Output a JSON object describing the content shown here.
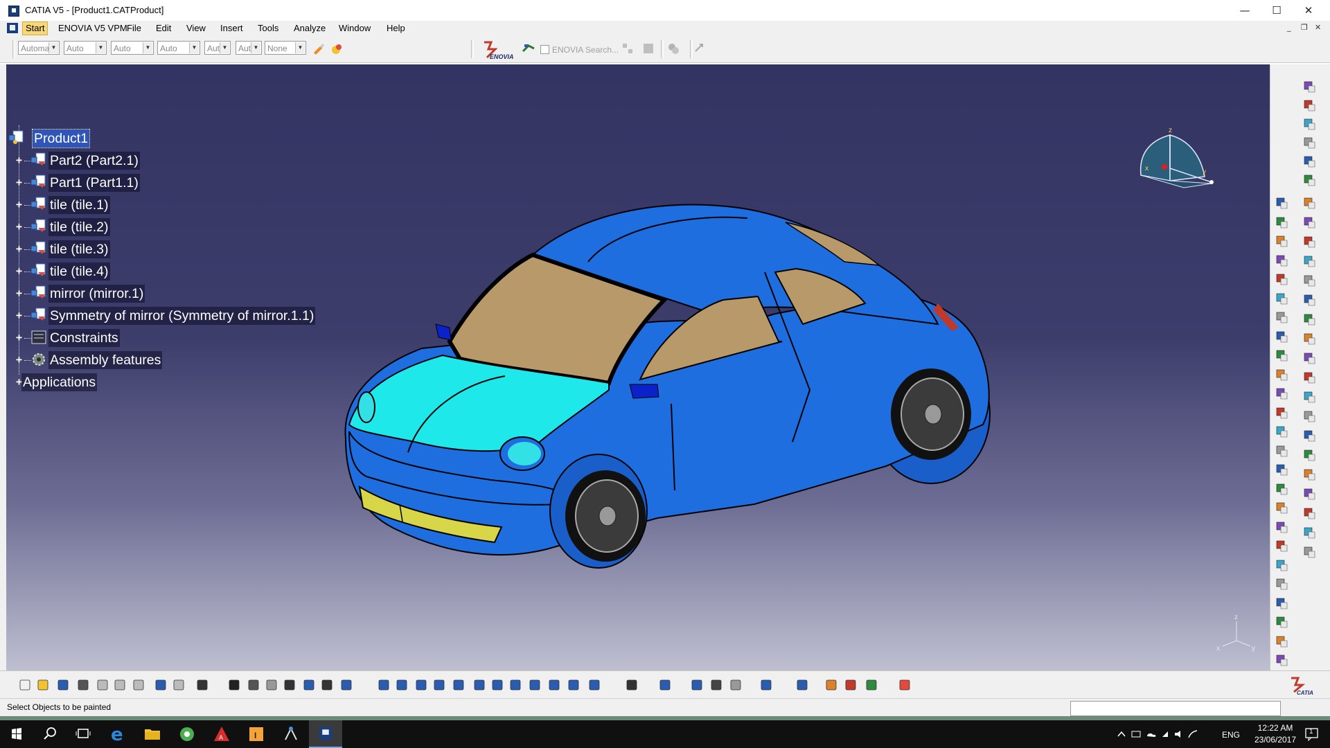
{
  "window": {
    "title": "CATIA V5 - [Product1.CATProduct]",
    "minimize": "—",
    "maximize": "☐",
    "close": "✕"
  },
  "menu": {
    "items": [
      "Start",
      "ENOVIA V5 VPM",
      "File",
      "Edit",
      "View",
      "Insert",
      "Tools",
      "Analyze",
      "Window",
      "Help"
    ],
    "mdi_controls": [
      "_",
      "❐",
      "✕"
    ]
  },
  "toolbar_top": {
    "combos": [
      "Automa",
      "Auto",
      "Auto",
      "Auto",
      "Aut",
      "Aut",
      "None"
    ],
    "enovia_search": "ENOVIA Search..."
  },
  "spec_tree": {
    "root": "Product1",
    "items": [
      "Part2 (Part2.1)",
      "Part1 (Part1.1)",
      "tile (tile.1)",
      "tile (tile.2)",
      "tile (tile.3)",
      "tile (tile.4)",
      "mirror (mirror.1)",
      "Symmetry of mirror (Symmetry of mirror.1.1)",
      "Constraints",
      "Assembly features",
      "Applications"
    ]
  },
  "compass": {
    "x": "x",
    "y": "y",
    "z": "z"
  },
  "axis_triad": {
    "x": "x",
    "y": "y",
    "z": "z"
  },
  "status": {
    "message": "Select Objects to be painted",
    "input_value": ""
  },
  "taskbar": {
    "language": "ENG",
    "time": "12:22 AM",
    "date": "23/06/2017",
    "notifications": "1"
  },
  "colors": {
    "viewport_top": "#343463",
    "viewport_bottom": "#bfbfd1",
    "car_body": "#1e6ee0",
    "car_hood": "#1fe8ea",
    "car_glass": "#b89a6a",
    "car_bumper": "#d6d648",
    "selection": "#2f55b8"
  }
}
